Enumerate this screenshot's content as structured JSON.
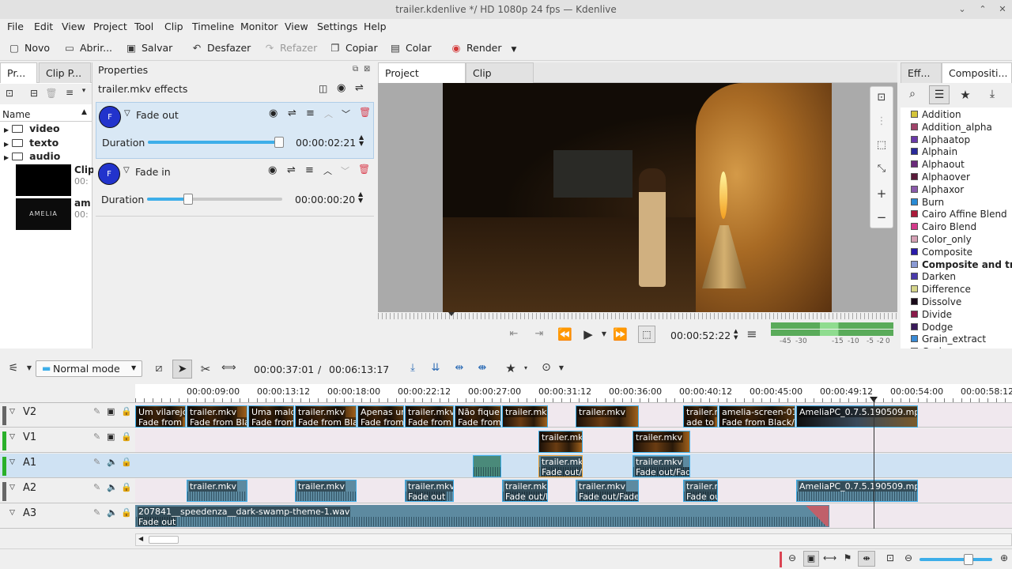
{
  "window": {
    "title": "trailer.kdenlive */ HD 1080p 24 fps — Kdenlive"
  },
  "menu": [
    "File",
    "Edit",
    "View",
    "Project",
    "Tool",
    "Clip",
    "Timeline",
    "Monitor",
    "View",
    "Settings",
    "Help"
  ],
  "toolbar": {
    "new": "Novo",
    "open": "Abrir...",
    "save": "Salvar",
    "undo": "Desfazer",
    "redo": "Refazer",
    "copy": "Copiar",
    "paste": "Colar",
    "render": "Render"
  },
  "bin": {
    "tab1": "Pr...",
    "tab2": "Clip P...",
    "header_name": "Name",
    "folders": [
      "video",
      "texto",
      "audio"
    ],
    "clip1_name": "Clip",
    "clip1_dur": "00:",
    "clip2_name": "am",
    "clip2_dur": "00:",
    "thumb2_text": "AMELIA"
  },
  "properties": {
    "title": "Properties",
    "heading": "trailer.mkv effects",
    "effects": [
      {
        "badge": "F",
        "name": "Fade out",
        "param": "Duration",
        "value": "00:00:02:21",
        "level": 0.97
      },
      {
        "badge": "F",
        "name": "Fade in",
        "param": "Duration",
        "value": "00:00:00:20",
        "level": 0.3
      }
    ]
  },
  "monitor": {
    "tab_project": "Project Monitor",
    "tab_clip": "Clip Monitor",
    "timecode": "00:00:52:22",
    "meter_labels": [
      "-45",
      "-30",
      "-15",
      "-10",
      "-5",
      "-2",
      "0"
    ]
  },
  "compositions": {
    "tab1": "Eff...",
    "tab2": "Compositi...",
    "items": [
      {
        "name": "Addition",
        "color": "#d4c43a"
      },
      {
        "name": "Addition_alpha",
        "color": "#a0436a"
      },
      {
        "name": "Alphaatop",
        "color": "#6a3aa8"
      },
      {
        "name": "Alphain",
        "color": "#2a2a9a"
      },
      {
        "name": "Alphaout",
        "color": "#6a2a7a"
      },
      {
        "name": "Alphaover",
        "color": "#5a1a3a"
      },
      {
        "name": "Alphaxor",
        "color": "#8a5aaa"
      },
      {
        "name": "Burn",
        "color": "#2a8ad4"
      },
      {
        "name": "Cairo Affine Blend",
        "color": "#aa1a3a"
      },
      {
        "name": "Cairo Blend",
        "color": "#d43a8a"
      },
      {
        "name": "Color_only",
        "color": "#d4a0b4"
      },
      {
        "name": "Composite",
        "color": "#2a1aaa"
      },
      {
        "name": "Composite and tra",
        "color": "#8a9ad4",
        "bold": true
      },
      {
        "name": "Darken",
        "color": "#4a3aaa"
      },
      {
        "name": "Difference",
        "color": "#d4d48a"
      },
      {
        "name": "Dissolve",
        "color": "#1a0a1a"
      },
      {
        "name": "Divide",
        "color": "#8a1a4a"
      },
      {
        "name": "Dodge",
        "color": "#3a1a5a"
      },
      {
        "name": "Grain_extract",
        "color": "#3a8ad4"
      },
      {
        "name": "Grain_merge",
        "color": "#3a8ad4"
      }
    ]
  },
  "timeline": {
    "mode": "Normal mode",
    "position": "00:00:37:01",
    "duration": "00:06:13:17",
    "ruler": [
      "00:00:09:00",
      "00:00:13:12",
      "00:00:18:00",
      "00:00:22:12",
      "00:00:27:00",
      "00:00:31:12",
      "00:00:36:00",
      "00:00:40:12",
      "00:00:45:00",
      "00:00:49:12",
      "00:00:54:00",
      "00:00:58:12"
    ],
    "tracks": [
      "V2",
      "V1",
      "A1",
      "A2",
      "A3"
    ],
    "v2_clips": [
      {
        "t": "Um vilarejo",
        "b": "Fade from"
      },
      {
        "t": "trailer.mkv",
        "b": "Fade from Bla"
      },
      {
        "t": "Uma maldi",
        "b": "Fade from"
      },
      {
        "t": "trailer.mkv",
        "b": "Fade from Blac"
      },
      {
        "t": "Apenas um",
        "b": "Fade from"
      },
      {
        "t": "trailer.mkv",
        "b": "Fade from B"
      },
      {
        "t": "Não fique n",
        "b": "Fade from"
      },
      {
        "t": "trailer.mkv",
        "b": ""
      },
      {
        "t": "trailer.mkv",
        "b": ""
      },
      {
        "t": "trailer.m",
        "b": "ade to"
      },
      {
        "t": "amelia-screen-01.j",
        "b": "Fade from Black/F"
      },
      {
        "t": "AmeliaPC_0.7.5.190509.mp4",
        "b": ""
      }
    ],
    "v1_clips": [
      {
        "t": "trailer.mkv"
      },
      {
        "t": "trailer.mkv"
      }
    ],
    "a1_clips": [
      {
        "t": "trailer.mkv",
        "b": "Fade out/F"
      },
      {
        "t": "trailer.mkv",
        "b": "Fade out/Fade"
      }
    ],
    "a2_clips": [
      {
        "t": "trailer.mkv",
        "b": ""
      },
      {
        "t": "trailer.mkv",
        "b": ""
      },
      {
        "t": "trailer.mkv",
        "b": "Fade out"
      },
      {
        "t": "trailer.mkv",
        "b": "Fade out/F"
      },
      {
        "t": "trailer.mkv",
        "b": "Fade out/Fade"
      },
      {
        "t": "trailer.m",
        "b": "Fade ou"
      },
      {
        "t": "AmeliaPC_0.7.5.190509.mp4",
        "b": ""
      }
    ],
    "a3_clip": {
      "t": "207841__speedenza__dark-swamp-theme-1.wav",
      "b": "Fade out"
    }
  }
}
